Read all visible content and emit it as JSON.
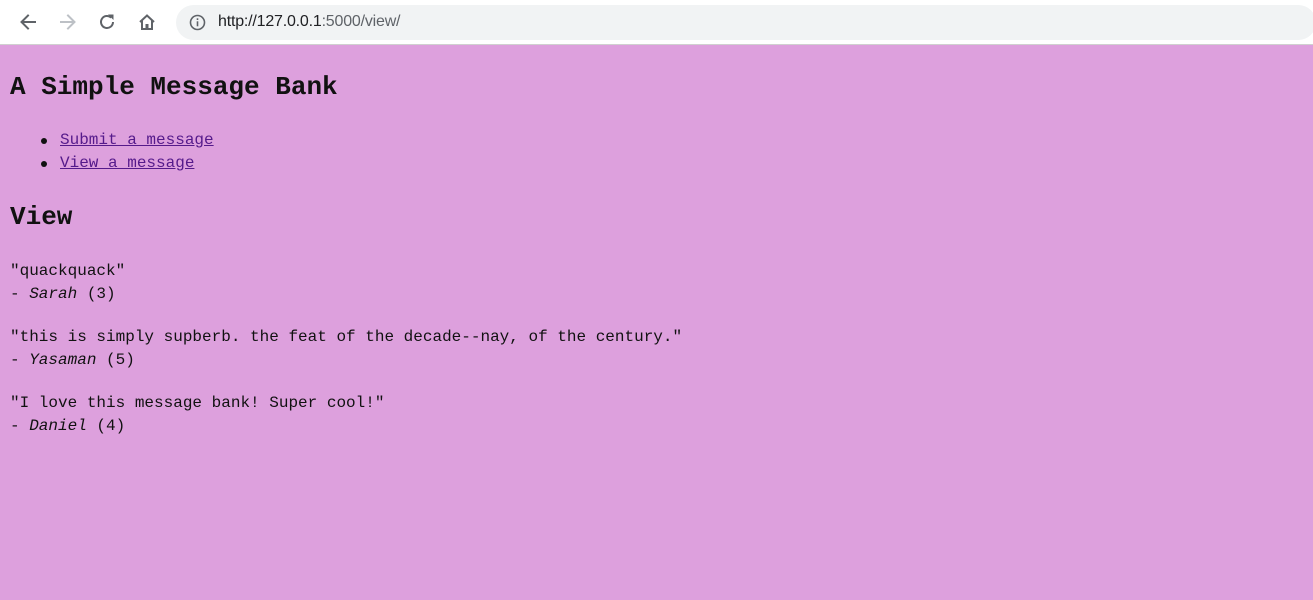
{
  "browser": {
    "url_host": "http://127.0.0.1",
    "url_path": ":5000/view/",
    "icons": [
      "back-arrow-icon",
      "forward-arrow-icon",
      "reload-icon",
      "home-icon",
      "info-icon"
    ]
  },
  "page": {
    "title": "A Simple Message Bank",
    "nav": [
      {
        "label": "Submit a message"
      },
      {
        "label": "View a message"
      }
    ],
    "section_title": "View",
    "messages": [
      {
        "text": "\"quackquack\"",
        "dash": "- ",
        "handle": "Sarah",
        "id": " (3)"
      },
      {
        "text": "\"this is simply supberb. the feat of the decade--nay, of the century.\"",
        "dash": "- ",
        "handle": "Yasaman",
        "id": " (5)"
      },
      {
        "text": "\"I love this message bank! Super cool!\"",
        "dash": "- ",
        "handle": "Daniel",
        "id": " (4)"
      }
    ]
  },
  "colors": {
    "page_background": "#dda0dd",
    "link": "#551a8b",
    "omnibox": "#f1f3f4"
  }
}
